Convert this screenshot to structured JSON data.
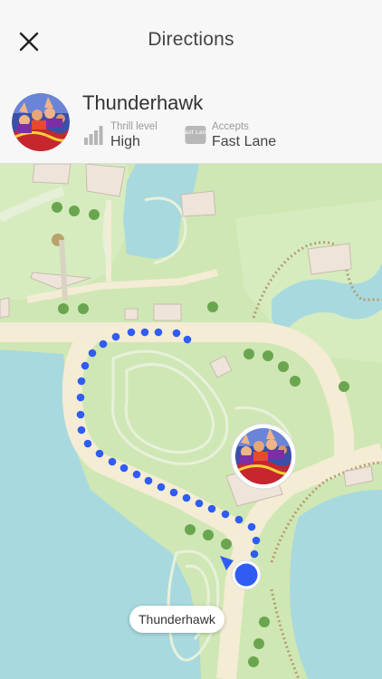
{
  "header": {
    "title": "Directions",
    "close_icon": "close-icon"
  },
  "ride": {
    "name": "Thunderhawk",
    "thrill": {
      "label": "Thrill level",
      "value": "High",
      "icon": "signal-bars-icon"
    },
    "access": {
      "label": "Accepts",
      "value": "Fast Lane",
      "icon": "fast-lane-icon",
      "badge_text": "Fast Lane"
    }
  },
  "map": {
    "callout_label": "Thunderhawk",
    "route_color": "#2f5cf2",
    "user_location_color": "#2f5cf2",
    "grass_color": "#cfe7b4",
    "water_color": "#a8d9df",
    "path_color": "#f4ecd4"
  }
}
